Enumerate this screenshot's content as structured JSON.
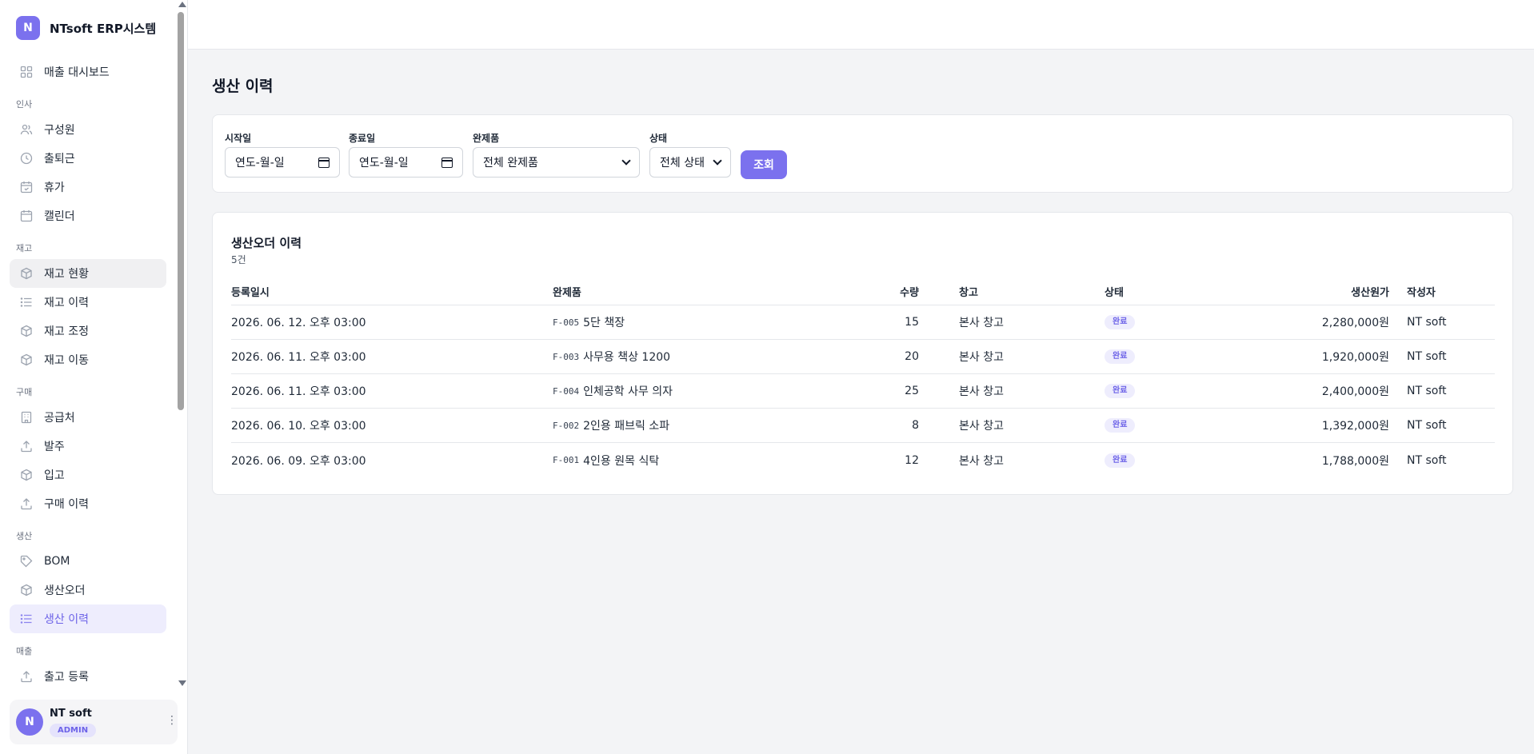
{
  "app": {
    "logo_letter": "N",
    "name": "NTsoft ERP시스템"
  },
  "sidebar": {
    "items": [
      {
        "type": "item",
        "label": "매출 대시보드",
        "icon": "grid-icon",
        "state": ""
      },
      {
        "type": "section",
        "label": "인사"
      },
      {
        "type": "item",
        "label": "구성원",
        "icon": "users-icon",
        "state": ""
      },
      {
        "type": "item",
        "label": "출퇴근",
        "icon": "clock-icon",
        "state": ""
      },
      {
        "type": "item",
        "label": "휴가",
        "icon": "calendar-check-icon",
        "state": ""
      },
      {
        "type": "item",
        "label": "캘린더",
        "icon": "calendar-icon",
        "state": ""
      },
      {
        "type": "section",
        "label": "재고"
      },
      {
        "type": "item",
        "label": "재고 현황",
        "icon": "box-icon",
        "state": "hover"
      },
      {
        "type": "item",
        "label": "재고 이력",
        "icon": "list-icon",
        "state": ""
      },
      {
        "type": "item",
        "label": "재고 조정",
        "icon": "box-icon",
        "state": ""
      },
      {
        "type": "item",
        "label": "재고 이동",
        "icon": "box-icon",
        "state": ""
      },
      {
        "type": "section",
        "label": "구매"
      },
      {
        "type": "item",
        "label": "공급처",
        "icon": "building-icon",
        "state": ""
      },
      {
        "type": "item",
        "label": "발주",
        "icon": "upload-icon",
        "state": ""
      },
      {
        "type": "item",
        "label": "입고",
        "icon": "box-icon",
        "state": ""
      },
      {
        "type": "item",
        "label": "구매 이력",
        "icon": "upload-icon",
        "state": ""
      },
      {
        "type": "section",
        "label": "생산"
      },
      {
        "type": "item",
        "label": "BOM",
        "icon": "tag-icon",
        "state": ""
      },
      {
        "type": "item",
        "label": "생산오더",
        "icon": "box-icon",
        "state": ""
      },
      {
        "type": "item",
        "label": "생산 이력",
        "icon": "list-icon",
        "state": "active"
      },
      {
        "type": "section",
        "label": "매출"
      },
      {
        "type": "item",
        "label": "출고 등록",
        "icon": "upload-icon",
        "state": ""
      }
    ]
  },
  "user": {
    "avatar_letter": "N",
    "name": "NT soft",
    "role": "ADMIN"
  },
  "page": {
    "title": "생산 이력"
  },
  "filters": {
    "start_label": "시작일",
    "start_value": "연도-월-일",
    "end_label": "종료일",
    "end_value": "연도-월-일",
    "product_label": "완제품",
    "product_value": "전체 완제품",
    "status_label": "상태",
    "status_value": "전체 상태",
    "search_label": "조회"
  },
  "list": {
    "title": "생산오더 이력",
    "count": "5건",
    "columns": {
      "date": "등록일시",
      "product": "완제품",
      "qty": "수량",
      "warehouse": "창고",
      "status": "상태",
      "cost": "생산원가",
      "author": "작성자"
    },
    "rows": [
      {
        "date": "2026. 06. 12. 오후 03:00",
        "code": "F-005",
        "product": "5단 책장",
        "qty": "15",
        "warehouse": "본사 창고",
        "status": "완료",
        "cost": "2,280,000원",
        "author": "NT soft"
      },
      {
        "date": "2026. 06. 11. 오후 03:00",
        "code": "F-003",
        "product": "사무용 책상 1200",
        "qty": "20",
        "warehouse": "본사 창고",
        "status": "완료",
        "cost": "1,920,000원",
        "author": "NT soft"
      },
      {
        "date": "2026. 06. 11. 오후 03:00",
        "code": "F-004",
        "product": "인체공학 사무 의자",
        "qty": "25",
        "warehouse": "본사 창고",
        "status": "완료",
        "cost": "2,400,000원",
        "author": "NT soft"
      },
      {
        "date": "2026. 06. 10. 오후 03:00",
        "code": "F-002",
        "product": "2인용 패브릭 소파",
        "qty": "8",
        "warehouse": "본사 창고",
        "status": "완료",
        "cost": "1,392,000원",
        "author": "NT soft"
      },
      {
        "date": "2026. 06. 09. 오후 03:00",
        "code": "F-001",
        "product": "4인용 원목 식탁",
        "qty": "12",
        "warehouse": "본사 창고",
        "status": "완료",
        "cost": "1,788,000원",
        "author": "NT soft"
      }
    ]
  },
  "colors": {
    "accent": "#7b71ee",
    "active_bg": "#eeedfd",
    "active_text": "#6d63e8"
  }
}
